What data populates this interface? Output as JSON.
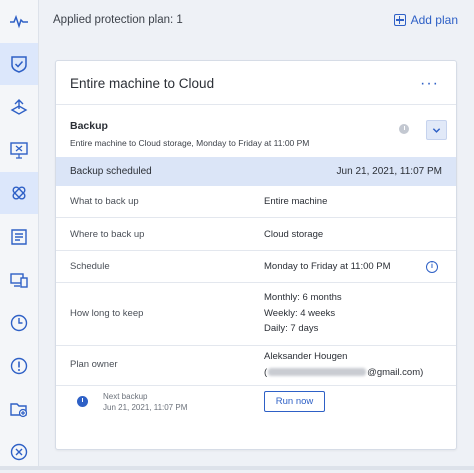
{
  "sidebar": {
    "items": [
      {
        "name": "pulse-icon"
      },
      {
        "name": "shield-check-icon"
      },
      {
        "name": "upload-icon"
      },
      {
        "name": "monitor-icon"
      },
      {
        "name": "bandage-icon"
      },
      {
        "name": "receipt-icon"
      },
      {
        "name": "devices-icon"
      },
      {
        "name": "clock-icon"
      },
      {
        "name": "alert-icon"
      },
      {
        "name": "folder-add-icon"
      },
      {
        "name": "close-circle-icon"
      }
    ],
    "active_index": 4,
    "accent_color": "#2e60c6"
  },
  "header": {
    "applied_plans": "Applied protection plan: 1",
    "add_plan": "Add plan"
  },
  "plan": {
    "title": "Entire machine to Cloud",
    "menu": "···",
    "backup": {
      "title": "Backup",
      "description": "Entire machine to Cloud storage, Monday to Friday at 11:00 PM"
    },
    "status": {
      "label": "Backup scheduled",
      "date": "Jun 21, 2021, 11:07 PM"
    },
    "details": [
      {
        "label": "What to back up",
        "value": "Entire machine"
      },
      {
        "label": "Where to back up",
        "value": "Cloud storage"
      },
      {
        "label": "Schedule",
        "value": "Monday to Friday at 11:00 PM"
      },
      {
        "label": "How long to keep",
        "values": [
          "Monthly: 6 months",
          "Weekly: 4 weeks",
          "Daily: 7 days"
        ]
      },
      {
        "label": "Plan owner",
        "owner_name": "Aleksander Hougen",
        "owner_email_prefix": "(",
        "owner_email_suffix": "@gmail.com)"
      }
    ],
    "next_backup": {
      "label": "Next backup",
      "date": "Jun 21, 2021, 11:07 PM"
    },
    "run_now": "Run now"
  }
}
